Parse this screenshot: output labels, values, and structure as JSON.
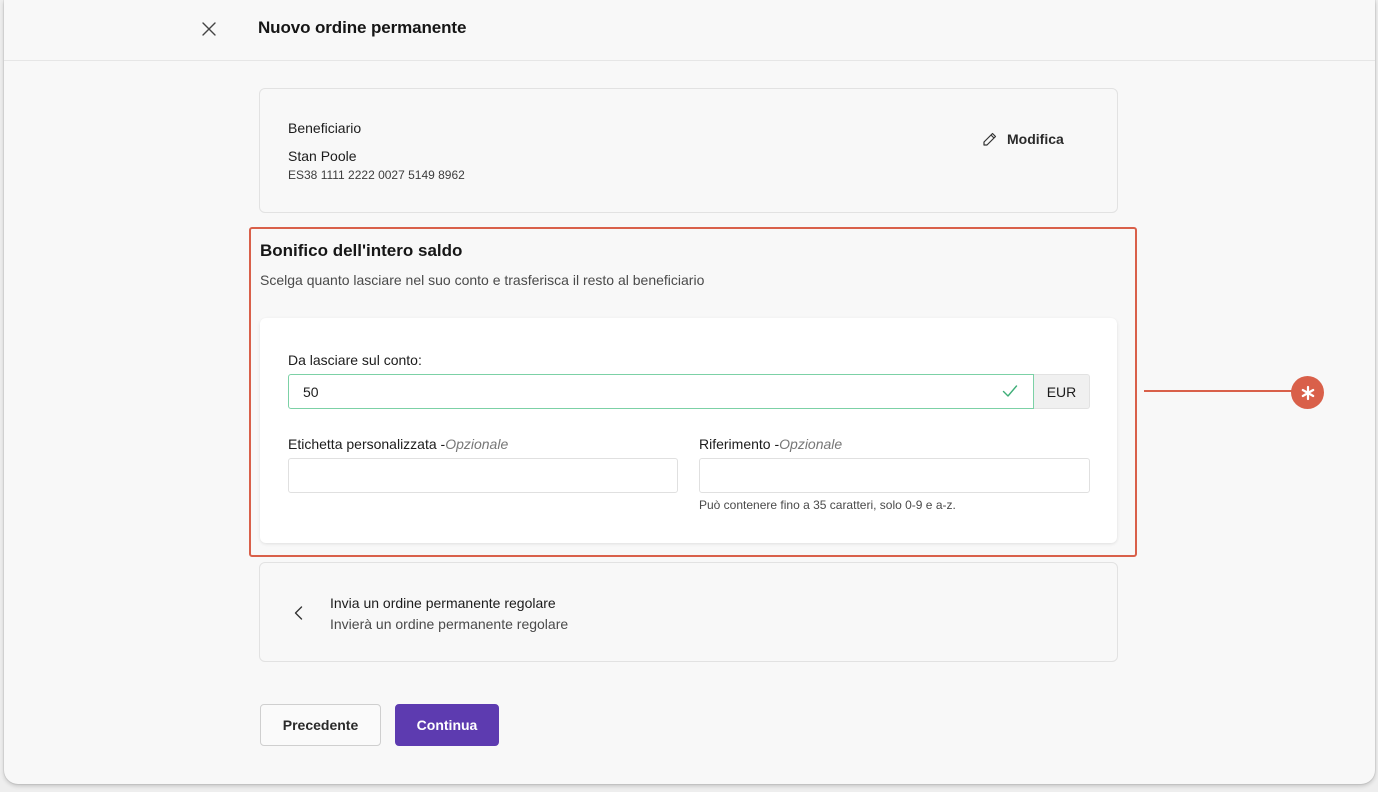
{
  "header": {
    "title": "Nuovo ordine permanente",
    "close_icon": "close-icon"
  },
  "beneficiary": {
    "label": "Beneficiario",
    "name": "Stan Poole",
    "iban": "ES38 1111 2222 0027 5149 8962",
    "edit_label": "Modifica",
    "edit_icon": "pencil-icon"
  },
  "full_balance": {
    "title": "Bonifico dell'intero saldo",
    "description": "Scelga quanto lasciare nel suo conto e trasferisca il resto al beneficiario",
    "amount_label": "Da lasciare sul conto:",
    "amount_value": "50",
    "currency": "EUR",
    "custom_label": "Etichetta personalizzata -",
    "custom_optional": "Opzionale",
    "custom_value": "",
    "reference_label": "Riferimento -",
    "reference_optional": "Opzionale",
    "reference_value": "",
    "reference_hint": "Può contenere fino a 35 caratteri, solo 0-9 e a-z."
  },
  "regular_order": {
    "title": "Invia un ordine permanente regolare",
    "subtitle": "Invierà un ordine permanente regolare",
    "icon": "chevron-left-icon"
  },
  "actions": {
    "prev_label": "Precedente",
    "next_label": "Continua"
  },
  "colors": {
    "accent": "#5d3bb0",
    "highlight": "#d9604a",
    "valid": "#7cd1a6"
  }
}
